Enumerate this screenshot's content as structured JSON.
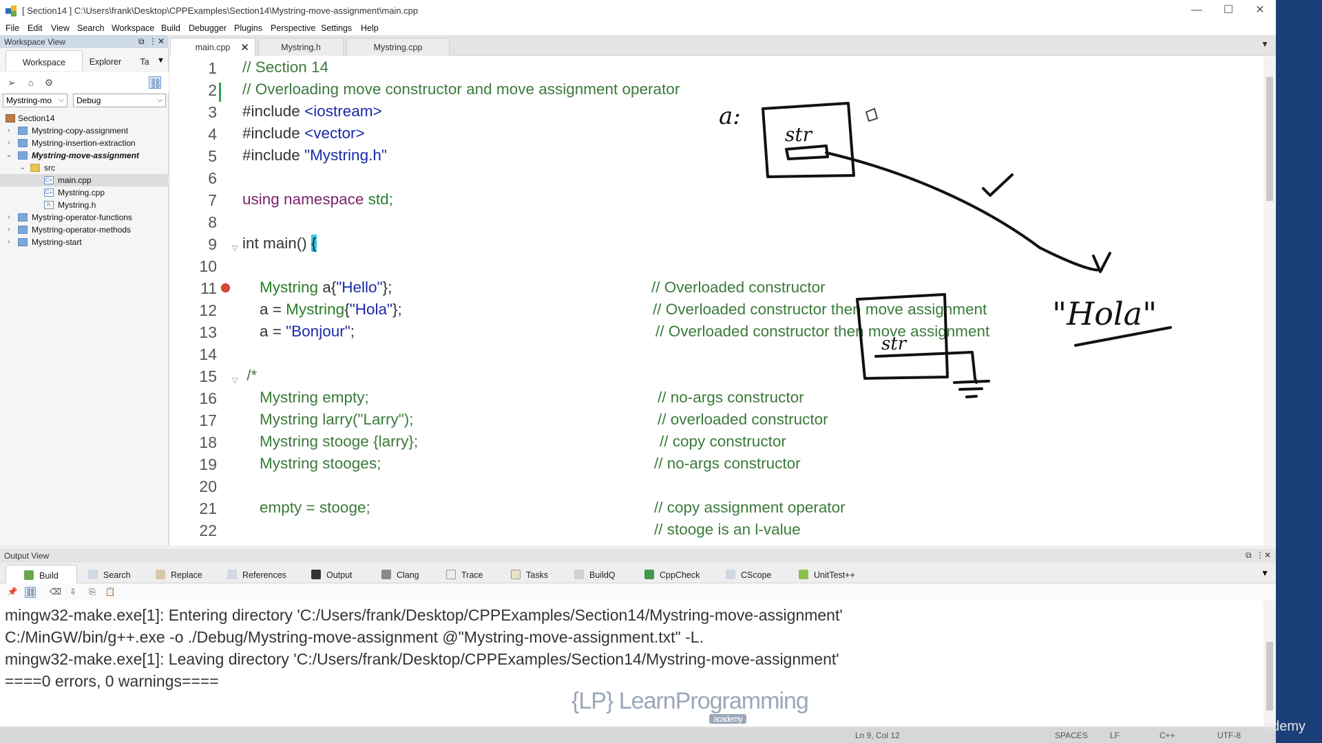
{
  "window": {
    "title": "[ Section14 ] C:\\Users\\frank\\Desktop\\CPPExamples\\Section14\\Mystring-move-assignment\\main.cpp",
    "minimize": "—",
    "maximize": "☐",
    "close": "✕"
  },
  "menu": [
    "File",
    "Edit",
    "View",
    "Search",
    "Workspace",
    "Build",
    "Debugger",
    "Plugins",
    "Perspective",
    "Settings",
    "Help"
  ],
  "workspace_view": {
    "title": "Workspace View",
    "tabs": [
      "Workspace",
      "Explorer",
      "Ta"
    ],
    "project_select": "Mystring-mo ",
    "config_select": "Debug",
    "tree": [
      {
        "label": "Section14"
      },
      {
        "label": "Mystring-copy-assignment"
      },
      {
        "label": "Mystring-insertion-extraction"
      },
      {
        "label": "Mystring-move-assignment"
      },
      {
        "label": "src"
      },
      {
        "label": "main.cpp"
      },
      {
        "label": "Mystring.cpp"
      },
      {
        "label": "Mystring.h"
      },
      {
        "label": "Mystring-operator-functions"
      },
      {
        "label": "Mystring-operator-methods"
      },
      {
        "label": "Mystring-start"
      }
    ]
  },
  "editor": {
    "tabs": [
      "main.cpp",
      "Mystring.h",
      "Mystring.cpp"
    ],
    "line_numbers": [
      "1",
      "2",
      "3",
      "4",
      "5",
      "6",
      "7",
      "8",
      "9",
      "10",
      "11",
      "12",
      "13",
      "14",
      "15",
      "16",
      "17",
      "18",
      "19",
      "20",
      "21",
      "22"
    ],
    "code": {
      "l1": "// Section 14",
      "l2": "// Overloading move constructor and move assignment operator",
      "l3a": "#include ",
      "l3b": "<iostream>",
      "l4a": "#include ",
      "l4b": "<vector>",
      "l5a": "#include ",
      "l5b": "\"Mystring.h\"",
      "l7a": "using namespace",
      "l7b": " std;",
      "l9a": "int main() ",
      "l9b": "{",
      "l11a": "    Mystring",
      "l11b": " a{",
      "l11c": "\"Hello\"",
      "l11d": "};",
      "l11e": "// Overloaded constructor",
      "l12a": "    a = ",
      "l12b": "Mystring",
      "l12c": "{",
      "l12d": "\"Hola\"",
      "l12e": "};",
      "l12f": "// Overloaded constructor then move assignment",
      "l13a": "    a = ",
      "l13b": "\"Bonjour\"",
      "l13c": ";",
      "l13d": "// Overloaded constructor then move assignment",
      "l15": " /*",
      "l16a": "    Mystring empty;",
      "l16b": "// no-args constructor",
      "l17a": "    Mystring larry(\"Larry\");",
      "l17b": "// overloaded constructor",
      "l18a": "    Mystring stooge {larry};",
      "l18b": "// copy constructor",
      "l19a": "    Mystring stooges;",
      "l19b": "// no-args constructor",
      "l21a": "    empty = stooge;",
      "l21b": "// copy assignment operator",
      "l22b": "// stooge is an l-value"
    }
  },
  "output_view": {
    "title": "Output View",
    "tabs": [
      "Build",
      "Search",
      "Replace",
      "References",
      "Output",
      "Clang",
      "Trace",
      "Tasks",
      "BuildQ",
      "CppCheck",
      "CScope",
      "UnitTest++"
    ],
    "lines": [
      "mingw32-make.exe[1]: Entering directory 'C:/Users/frank/Desktop/CPPExamples/Section14/Mystring-move-assignment'",
      "C:/MinGW/bin/g++.exe -o ./Debug/Mystring-move-assignment @\"Mystring-move-assignment.txt\" -L.",
      "mingw32-make.exe[1]: Leaving directory 'C:/Users/frank/Desktop/CPPExamples/Section14/Mystring-move-assignment'",
      "====0 errors, 0 warnings===="
    ]
  },
  "watermark": {
    "brand": "{LP} LearnProgramming",
    "sub": "academy",
    "udemy": "udemy"
  },
  "status": {
    "position": "Ln 9, Col 12",
    "indent": "SPACES",
    "eol": "LF",
    "lang": "C++",
    "encoding": "UTF-8"
  },
  "annotations": {
    "a_label": "a:",
    "str1": "str",
    "str2": "str",
    "hola": "\"Hola\""
  },
  "colors": {
    "comment": "#3a7a3a",
    "keyword": "#7a1f6a",
    "string": "#1a2aa8",
    "type": "#267f26",
    "bracket_highlight": "#35c8e8",
    "breakpoint": "#e0443a"
  }
}
